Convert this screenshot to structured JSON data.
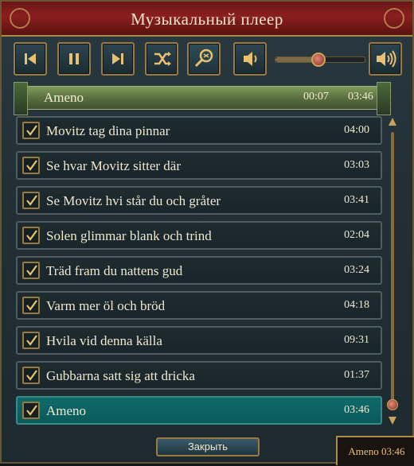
{
  "window": {
    "title": "Музыкальный плеер",
    "colors": {
      "title_bar": "#7a1a1a",
      "accent_gold": "#c9a35a",
      "selected_row": "#0f6a6a",
      "now_playing_bar": "#5a7040"
    }
  },
  "toolbar": {
    "buttons": [
      {
        "name": "previous-button",
        "icon": "skip-back-icon"
      },
      {
        "name": "pause-button",
        "icon": "pause-icon"
      },
      {
        "name": "next-button",
        "icon": "skip-forward-icon"
      },
      {
        "name": "shuffle-button",
        "icon": "shuffle-icon"
      },
      {
        "name": "search-button",
        "icon": "magnifier-icon"
      }
    ],
    "volume": {
      "min_icon": "speaker-low-icon",
      "max_icon": "speaker-high-icon",
      "level": 0.48
    }
  },
  "now_playing": {
    "title": "Ameno",
    "elapsed": "00:07",
    "duration": "03:46"
  },
  "playlist": [
    {
      "title": "Movitz tag dina pinnar",
      "duration": "04:00",
      "checked": true,
      "selected": false
    },
    {
      "title": "Se hvar Movitz sitter där",
      "duration": "03:03",
      "checked": true,
      "selected": false
    },
    {
      "title": "Se Movitz hvi står du och gråter",
      "duration": "03:41",
      "checked": true,
      "selected": false
    },
    {
      "title": "Solen glimmar blank och trind",
      "duration": "02:04",
      "checked": true,
      "selected": false
    },
    {
      "title": "Träd fram du nattens gud",
      "duration": "03:24",
      "checked": true,
      "selected": false
    },
    {
      "title": "Varm mer öl och bröd",
      "duration": "04:18",
      "checked": true,
      "selected": false
    },
    {
      "title": "Hvila vid denna källa",
      "duration": "09:31",
      "checked": true,
      "selected": false
    },
    {
      "title": "Gubbarna satt sig att dricka",
      "duration": "01:37",
      "checked": true,
      "selected": false
    },
    {
      "title": "Ameno",
      "duration": "03:46",
      "checked": true,
      "selected": true
    }
  ],
  "scrollbar": {
    "position": 1.0
  },
  "footer": {
    "close_label": "Закрыть",
    "status_text": "Ameno 03:46"
  }
}
